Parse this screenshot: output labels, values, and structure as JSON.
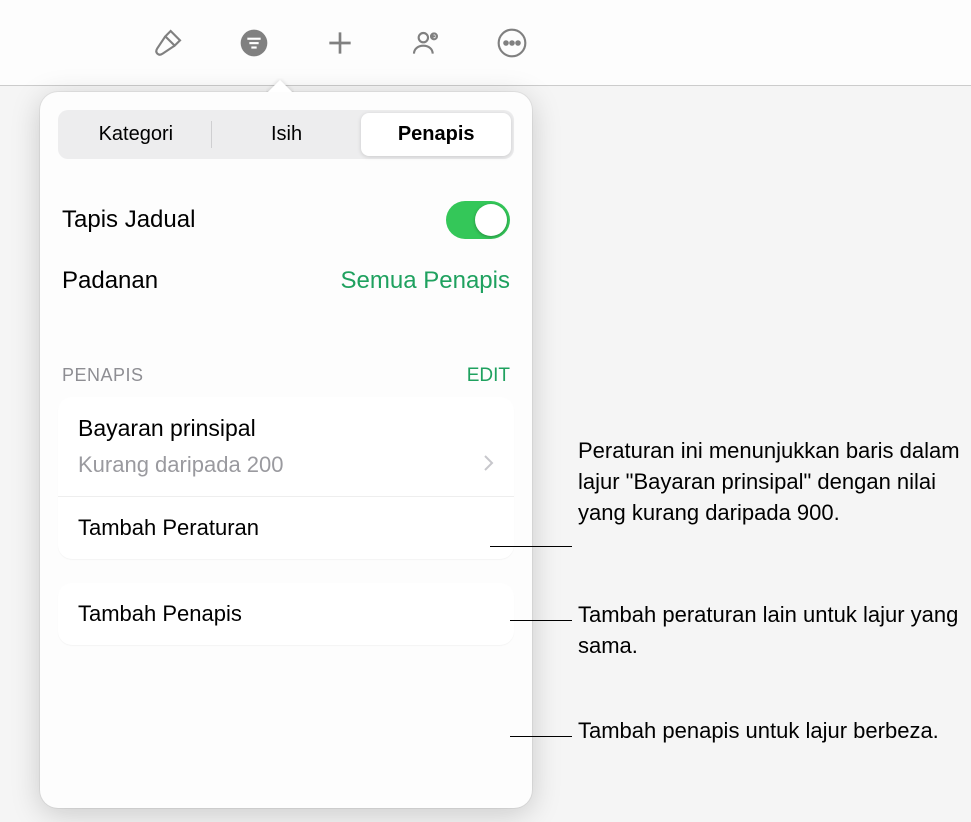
{
  "toolbar": {
    "icons": [
      "format-brush-icon",
      "organize-icon",
      "plus-icon",
      "collaborate-icon",
      "more-icon"
    ]
  },
  "tabs": {
    "category": "Kategori",
    "sort": "Isih",
    "filter": "Penapis"
  },
  "filter_table": {
    "label": "Tapis Jadual",
    "enabled": true
  },
  "matching": {
    "label": "Padanan",
    "value": "Semua Penapis"
  },
  "filters_section": {
    "header": "Penapis",
    "edit": "EDIT"
  },
  "filter_rule": {
    "column": "Bayaran prinsipal",
    "condition": "Kurang daripada 200"
  },
  "add_rule": "Tambah Peraturan",
  "add_filter": "Tambah Penapis",
  "callouts": {
    "rule_desc": "Peraturan ini menunjukkan baris dalam lajur \"Bayaran prinsipal\" dengan nilai yang kurang daripada 900.",
    "add_rule_desc": "Tambah peraturan lain untuk lajur yang sama.",
    "add_filter_desc": "Tambah penapis untuk lajur berbeza."
  }
}
